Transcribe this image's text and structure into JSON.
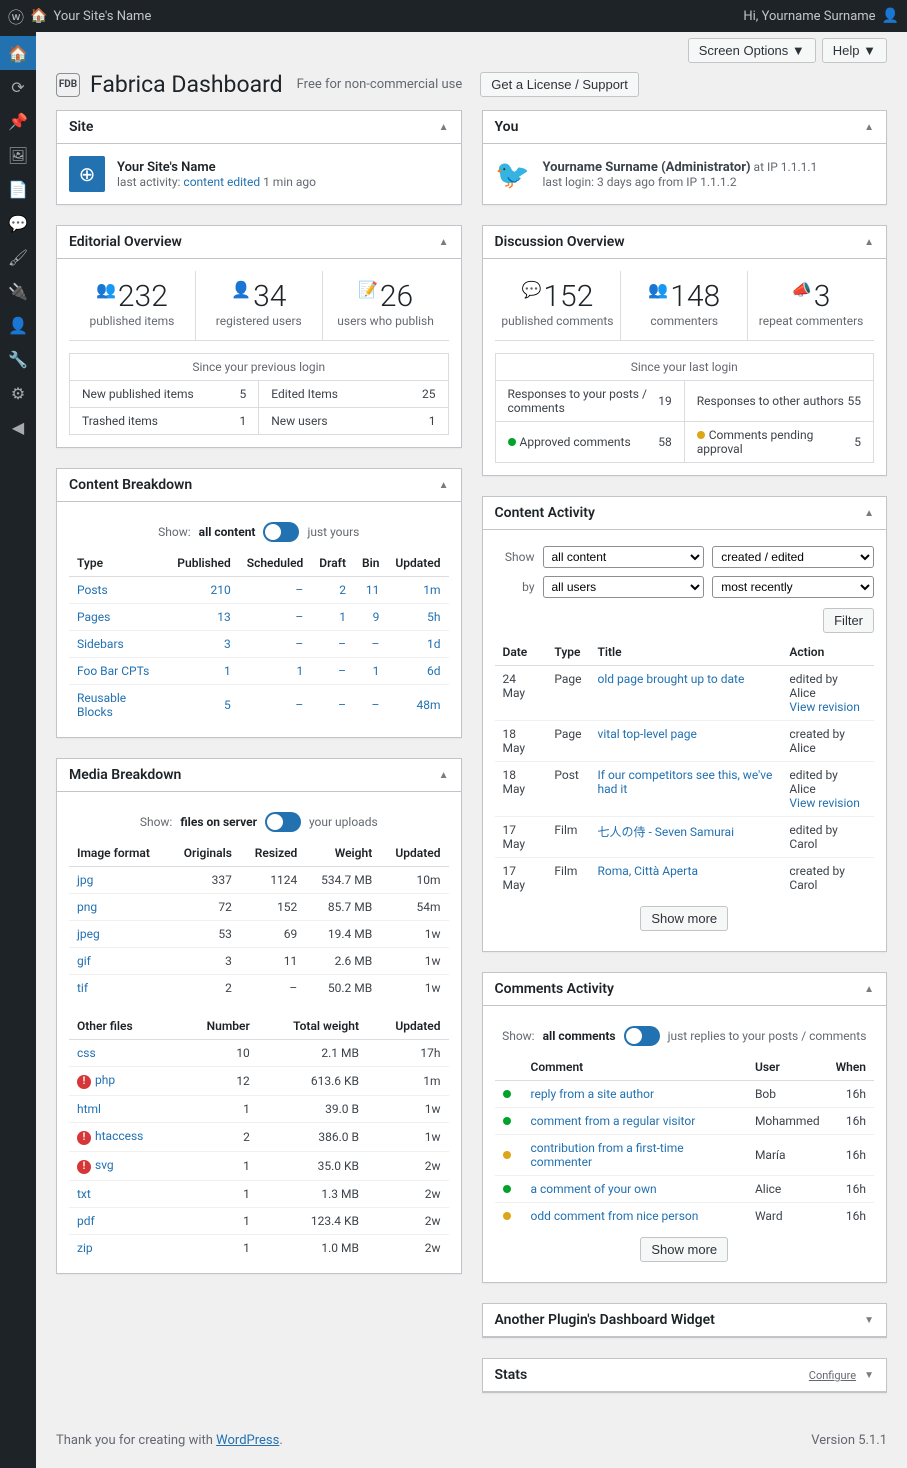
{
  "adminbar": {
    "site_name": "Your Site's Name",
    "greeting": "Hi, Yourname Surname"
  },
  "topcontrols": {
    "screen_options": "Screen Options ▼",
    "help": "Help ▼"
  },
  "header": {
    "logo_text": "FDB",
    "title": "Fabrica Dashboard",
    "subtitle": "Free for non-commercial use",
    "license_btn": "Get a License / Support"
  },
  "site_widget": {
    "title": "Site",
    "name": "Your Site's Name",
    "activity_prefix": "last activity: ",
    "activity_link": "content edited",
    "activity_suffix": " 1 min ago"
  },
  "you_widget": {
    "title": "You",
    "name": "Yourname Surname (Administrator)",
    "ip_suffix": " at IP 1.1.1.1",
    "last_login": "last login: 3 days ago from IP 1.1.1.2"
  },
  "editorial": {
    "title": "Editorial Overview",
    "stats": [
      {
        "num": "232",
        "label": "published items"
      },
      {
        "num": "34",
        "label": "registered users"
      },
      {
        "num": "26",
        "label": "users who publish"
      }
    ],
    "since": "Since your previous login",
    "rows": [
      [
        {
          "label": "New published items",
          "val": "5"
        },
        {
          "label": "Edited Items",
          "val": "25"
        }
      ],
      [
        {
          "label": "Trashed items",
          "val": "1"
        },
        {
          "label": "New users",
          "val": "1"
        }
      ]
    ]
  },
  "discussion": {
    "title": "Discussion Overview",
    "stats": [
      {
        "num": "152",
        "label": "published comments"
      },
      {
        "num": "148",
        "label": "commenters"
      },
      {
        "num": "3",
        "label": "repeat commenters"
      }
    ],
    "since": "Since your last login",
    "rows": [
      [
        {
          "label": "Responses to your posts / comments",
          "val": "19"
        },
        {
          "label": "Responses to other authors",
          "val": "55"
        }
      ],
      [
        {
          "label": "Approved comments",
          "val": "58",
          "dot": "green"
        },
        {
          "label": "Comments pending approval",
          "val": "5",
          "dot": "orange"
        }
      ]
    ]
  },
  "content_breakdown": {
    "title": "Content Breakdown",
    "toggle_prefix": "Show: ",
    "toggle_left": "all content",
    "toggle_right": "just yours",
    "cols": [
      "Type",
      "Published",
      "Scheduled",
      "Draft",
      "Bin",
      "Updated"
    ],
    "rows": [
      [
        "Posts",
        "210",
        "–",
        "2",
        "11",
        "1m"
      ],
      [
        "Pages",
        "13",
        "–",
        "1",
        "9",
        "5h"
      ],
      [
        "Sidebars",
        "3",
        "–",
        "–",
        "–",
        "1d"
      ],
      [
        "Foo Bar CPTs",
        "1",
        "1",
        "–",
        "1",
        "6d"
      ],
      [
        "Reusable Blocks",
        "5",
        "–",
        "–",
        "–",
        "48m"
      ]
    ]
  },
  "media_breakdown": {
    "title": "Media Breakdown",
    "toggle_prefix": "Show: ",
    "toggle_left": "files on server",
    "toggle_right": "your uploads",
    "img_cols": [
      "Image format",
      "Originals",
      "Resized",
      "Weight",
      "Updated"
    ],
    "img_rows": [
      [
        "jpg",
        "337",
        "1124",
        "534.7 MB",
        "10m"
      ],
      [
        "png",
        "72",
        "152",
        "85.7 MB",
        "54m"
      ],
      [
        "jpeg",
        "53",
        "69",
        "19.4 MB",
        "1w"
      ],
      [
        "gif",
        "3",
        "11",
        "2.6 MB",
        "1w"
      ],
      [
        "tif",
        "2",
        "–",
        "50.2 MB",
        "1w"
      ]
    ],
    "other_cols": [
      "Other files",
      "Number",
      "Total weight",
      "Updated"
    ],
    "other_rows": [
      {
        "type": "css",
        "num": "10",
        "weight": "2.1 MB",
        "updated": "17h",
        "warn": false
      },
      {
        "type": "php",
        "num": "12",
        "weight": "613.6 KB",
        "updated": "1m",
        "warn": true
      },
      {
        "type": "html",
        "num": "1",
        "weight": "39.0 B",
        "updated": "1w",
        "warn": false
      },
      {
        "type": "htaccess",
        "num": "2",
        "weight": "386.0 B",
        "updated": "1w",
        "warn": true
      },
      {
        "type": "svg",
        "num": "1",
        "weight": "35.0 KB",
        "updated": "2w",
        "warn": true
      },
      {
        "type": "txt",
        "num": "1",
        "weight": "1.3 MB",
        "updated": "2w",
        "warn": false
      },
      {
        "type": "pdf",
        "num": "1",
        "weight": "123.4 KB",
        "updated": "2w",
        "warn": false
      },
      {
        "type": "zip",
        "num": "1",
        "weight": "1.0 MB",
        "updated": "2w",
        "warn": false
      }
    ]
  },
  "content_activity": {
    "title": "Content Activity",
    "show_label": "Show",
    "by_label": "by",
    "sel_content": "all content",
    "sel_action": "created / edited",
    "sel_users": "all users",
    "sel_order": "most recently",
    "filter_btn": "Filter",
    "cols": [
      "Date",
      "Type",
      "Title",
      "Action"
    ],
    "rows": [
      {
        "date": "24 May",
        "type": "Page",
        "title": "old page brought up to date",
        "action": "edited by Alice",
        "revision": "View revision"
      },
      {
        "date": "18 May",
        "type": "Page",
        "title": "vital top-level page",
        "action": "created by Alice"
      },
      {
        "date": "18 May",
        "type": "Post",
        "title": "If our competitors see this, we've had it",
        "action": "edited by Alice",
        "revision": "View revision"
      },
      {
        "date": "17 May",
        "type": "Film",
        "title": "七人の侍 - Seven Samurai",
        "action": "edited by Carol"
      },
      {
        "date": "17 May",
        "type": "Film",
        "title": "Roma, Città Aperta",
        "action": "created by Carol"
      }
    ],
    "show_more": "Show more"
  },
  "comments_activity": {
    "title": "Comments Activity",
    "toggle_prefix": "Show: ",
    "toggle_left": "all comments",
    "toggle_right": "just replies to your posts / comments",
    "cols": [
      "Comment",
      "User",
      "When"
    ],
    "rows": [
      {
        "dot": "green",
        "comment": "reply from a site author",
        "user": "Bob",
        "when": "16h"
      },
      {
        "dot": "green",
        "comment": "comment from a regular visitor",
        "user": "Mohammed",
        "when": "16h"
      },
      {
        "dot": "orange",
        "comment": "contribution from a first-time commenter",
        "user": "María",
        "when": "16h"
      },
      {
        "dot": "green",
        "comment": "a comment of your own",
        "user": "Alice",
        "when": "16h"
      },
      {
        "dot": "orange",
        "comment": "odd comment from nice person",
        "user": "Ward",
        "when": "16h"
      }
    ],
    "show_more": "Show more"
  },
  "other_widgets": {
    "another": "Another Plugin's Dashboard Widget",
    "stats": "Stats",
    "configure": "Configure"
  },
  "footer": {
    "thanks_prefix": "Thank you for creating with ",
    "wp_link": "WordPress",
    "thanks_suffix": ".",
    "version": "Version 5.1.1"
  }
}
